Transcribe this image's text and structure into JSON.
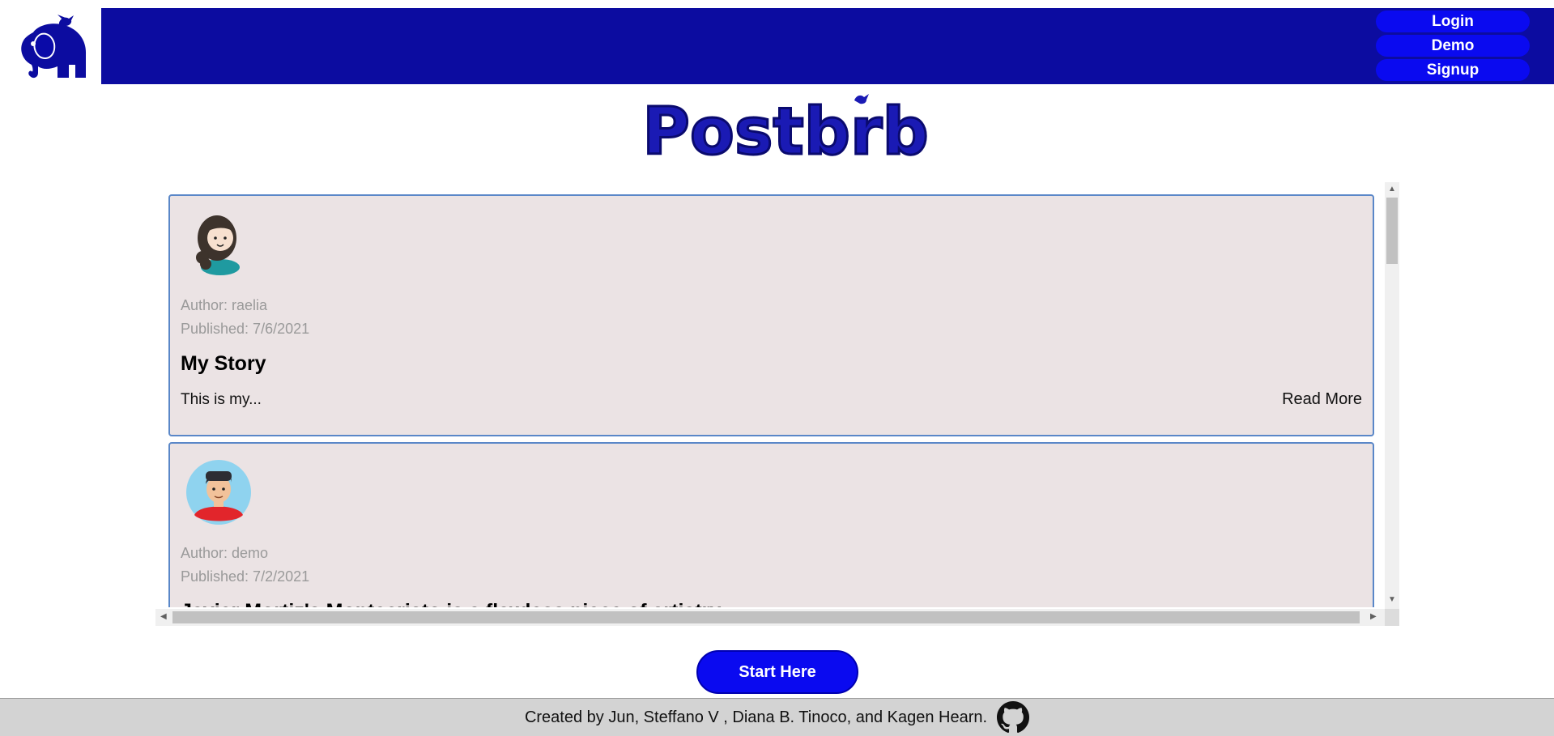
{
  "header": {
    "logo_icon": "elephant-with-bird-icon",
    "nav_buttons": [
      "Login",
      "Demo",
      "Signup"
    ],
    "colors": {
      "navband": "#0c0ca0",
      "button": "#0a0af0"
    }
  },
  "brand": {
    "title": "Postbrb"
  },
  "posts": [
    {
      "avatar_icon": "woman-avatar-icon",
      "author": "Author: raelia",
      "published": "Published: 7/6/2021",
      "title": "My Story",
      "excerpt": "This is my...",
      "read_more": "Read More"
    },
    {
      "avatar_icon": "man-avatar-icon",
      "author": "Author: demo",
      "published": "Published: 7/2/2021",
      "title": "Javier Mortiz's Montecristo is a flawless piece of artistry"
    }
  ],
  "cta": {
    "label": "Start Here"
  },
  "footer": {
    "credits": "Created by Jun, Steffano V , Diana B. Tinoco, and Kagen Hearn.",
    "github_icon": "github-icon"
  }
}
